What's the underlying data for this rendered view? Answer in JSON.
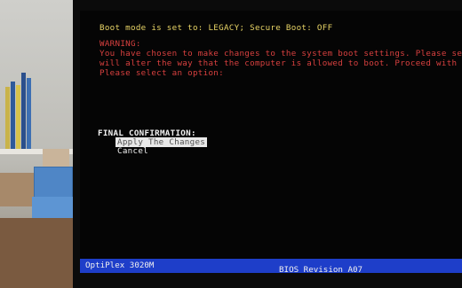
{
  "screen": {
    "boot_mode": "Boot mode is set to: LEGACY; Secure Boot: OFF",
    "warning_title": "WARNING:",
    "warning_lines": [
      "You have chosen to make changes to the system boot settings. Please setti",
      "will alter the way that the computer is allowed to boot. Proceed with ca",
      "Please select an option:"
    ],
    "final_confirmation": "FINAL CONFIRMATION:",
    "options": [
      "Apply The Changes",
      "Cancel"
    ],
    "selected_option": "Apply The Changes"
  },
  "status_bar": {
    "model": "OptiPlex 3020M",
    "bios_revision": "BIOS Revision A07"
  },
  "colors": {
    "warning": "#d8403f",
    "info": "#e8d466",
    "status_bar": "#1e3ec9"
  }
}
